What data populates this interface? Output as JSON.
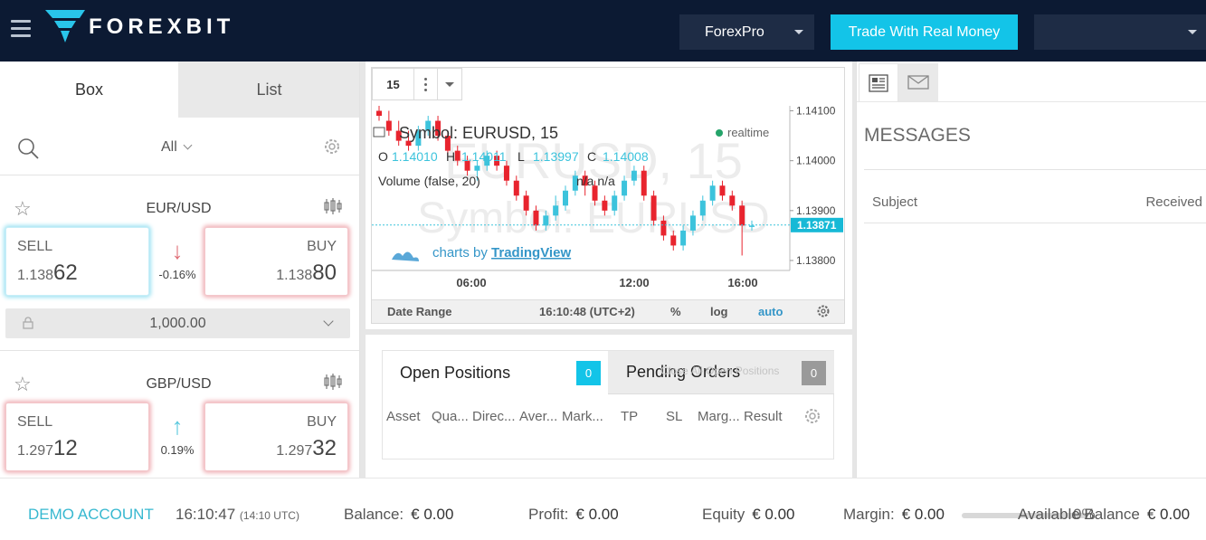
{
  "header": {
    "brand": "FOREXBIT",
    "account_selector": "ForexPro",
    "real_money_button": "Trade With Real Money",
    "user_selector": ""
  },
  "left_panel": {
    "tabs": [
      "Box",
      "List"
    ],
    "filter": "All",
    "pairs": [
      {
        "symbol": "EUR/USD",
        "sell_label": "SELL",
        "sell_prefix": "1.138",
        "sell_pips": "62",
        "buy_label": "BUY",
        "buy_prefix": "1.138",
        "buy_pips": "80",
        "change": "-0.16%",
        "direction": "down",
        "amount": "1,000.00"
      },
      {
        "symbol": "GBP/USD",
        "sell_label": "SELL",
        "sell_prefix": "1.297",
        "sell_pips": "12",
        "buy_label": "BUY",
        "buy_prefix": "1.297",
        "buy_pips": "32",
        "change": "0.19%",
        "direction": "up"
      }
    ]
  },
  "chart": {
    "interval": "15",
    "watermark_line1": "EURUSD, 15",
    "watermark_line2": "Symbol: EURUSD",
    "legend_title": "Symbol: EURUSD, 15",
    "realtime": "realtime",
    "ohlc": {
      "o_label": "O",
      "o": "1.14010",
      "h_label": "H",
      "h": "1.14011",
      "l_label": "L",
      "l": "1.13997",
      "c_label": "C",
      "c": "1.14008"
    },
    "volume_label": "Volume (false, 20)",
    "volume_values": "n/a  n/a",
    "attribution_prefix": "charts by",
    "attribution_brand": "TradingView",
    "footer": {
      "date_range": "Date Range",
      "time": "16:10:48 (UTC+2)",
      "percent": "%",
      "log": "log",
      "auto": "auto"
    },
    "colors": {
      "up": "#3cc3dc",
      "down": "#e8242e"
    }
  },
  "chart_data": {
    "type": "candlestick",
    "title": "Symbol: EURUSD, 15",
    "x_ticks": [
      "06:00",
      "12:00",
      "16:00"
    ],
    "y_ticks": [
      "1.14100",
      "1.14000",
      "1.13900",
      "1.13800"
    ],
    "ylim": [
      1.1378,
      1.1411
    ],
    "last_price": "1.13871",
    "candles": [
      {
        "o": 1.141,
        "c": 1.1409,
        "h": 1.1411,
        "l": 1.1408
      },
      {
        "o": 1.1408,
        "c": 1.1406,
        "h": 1.141,
        "l": 1.1405
      },
      {
        "o": 1.1406,
        "c": 1.1404,
        "h": 1.1408,
        "l": 1.1403
      },
      {
        "o": 1.1404,
        "c": 1.1403,
        "h": 1.1406,
        "l": 1.1402
      },
      {
        "o": 1.1403,
        "c": 1.1406,
        "h": 1.1407,
        "l": 1.1402
      },
      {
        "o": 1.1406,
        "c": 1.1408,
        "h": 1.1409,
        "l": 1.1405
      },
      {
        "o": 1.1408,
        "c": 1.1405,
        "h": 1.1409,
        "l": 1.1404
      },
      {
        "o": 1.1405,
        "c": 1.1402,
        "h": 1.1406,
        "l": 1.1401
      },
      {
        "o": 1.1402,
        "c": 1.14,
        "h": 1.1403,
        "l": 1.1399
      },
      {
        "o": 1.14,
        "c": 1.1398,
        "h": 1.1401,
        "l": 1.1397
      },
      {
        "o": 1.1398,
        "c": 1.1399,
        "h": 1.14,
        "l": 1.1396
      },
      {
        "o": 1.1399,
        "c": 1.1401,
        "h": 1.1402,
        "l": 1.1398
      },
      {
        "o": 1.1401,
        "c": 1.1399,
        "h": 1.1402,
        "l": 1.1398
      },
      {
        "o": 1.1399,
        "c": 1.1396,
        "h": 1.14,
        "l": 1.1395
      },
      {
        "o": 1.1396,
        "c": 1.1393,
        "h": 1.1397,
        "l": 1.1392
      },
      {
        "o": 1.1393,
        "c": 1.139,
        "h": 1.1394,
        "l": 1.1389
      },
      {
        "o": 1.139,
        "c": 1.1387,
        "h": 1.1391,
        "l": 1.1386
      },
      {
        "o": 1.1387,
        "c": 1.1389,
        "h": 1.139,
        "l": 1.1386
      },
      {
        "o": 1.1389,
        "c": 1.1391,
        "h": 1.1393,
        "l": 1.1388
      },
      {
        "o": 1.1391,
        "c": 1.1394,
        "h": 1.1395,
        "l": 1.139
      },
      {
        "o": 1.1394,
        "c": 1.1397,
        "h": 1.1398,
        "l": 1.1393
      },
      {
        "o": 1.1397,
        "c": 1.1395,
        "h": 1.1398,
        "l": 1.1393
      },
      {
        "o": 1.1395,
        "c": 1.1392,
        "h": 1.1396,
        "l": 1.1391
      },
      {
        "o": 1.1392,
        "c": 1.139,
        "h": 1.1393,
        "l": 1.1389
      },
      {
        "o": 1.139,
        "c": 1.1393,
        "h": 1.1394,
        "l": 1.1389
      },
      {
        "o": 1.1393,
        "c": 1.1396,
        "h": 1.1397,
        "l": 1.1392
      },
      {
        "o": 1.1396,
        "c": 1.1398,
        "h": 1.1399,
        "l": 1.1395
      },
      {
        "o": 1.1398,
        "c": 1.1393,
        "h": 1.1399,
        "l": 1.1392
      },
      {
        "o": 1.1393,
        "c": 1.1388,
        "h": 1.1394,
        "l": 1.1387
      },
      {
        "o": 1.1388,
        "c": 1.1385,
        "h": 1.1389,
        "l": 1.1384
      },
      {
        "o": 1.1385,
        "c": 1.1383,
        "h": 1.1386,
        "l": 1.1382
      },
      {
        "o": 1.1383,
        "c": 1.1386,
        "h": 1.1387,
        "l": 1.1382
      },
      {
        "o": 1.1386,
        "c": 1.1389,
        "h": 1.139,
        "l": 1.1385
      },
      {
        "o": 1.1389,
        "c": 1.1392,
        "h": 1.1393,
        "l": 1.1388
      },
      {
        "o": 1.1392,
        "c": 1.1395,
        "h": 1.1396,
        "l": 1.1391
      },
      {
        "o": 1.1395,
        "c": 1.1393,
        "h": 1.1396,
        "l": 1.1392
      },
      {
        "o": 1.1393,
        "c": 1.1391,
        "h": 1.1394,
        "l": 1.139
      },
      {
        "o": 1.1391,
        "c": 1.1387,
        "h": 1.1392,
        "l": 1.1381
      },
      {
        "o": 1.1387,
        "c": 1.1387,
        "h": 1.1388,
        "l": 1.1386
      }
    ]
  },
  "positions": {
    "open_label": "Open Positions",
    "open_count": "0",
    "pending_label": "Pending Orders",
    "pending_count": "0",
    "close_all": "Close All Open Positions",
    "columns": [
      "Asset",
      "Qua...",
      "Direc...",
      "Aver...",
      "Mark...",
      "TP",
      "SL",
      "Marg...",
      "Result"
    ]
  },
  "messages": {
    "title": "MESSAGES",
    "subject": "Subject",
    "received": "Received"
  },
  "footer": {
    "demo_label": "DEMO ACCOUNT",
    "time": "16:10:47",
    "time_utc": "(14:10 UTC)",
    "balance_label": "Balance:",
    "balance": "€ 0.00",
    "profit_label": "Profit:",
    "profit": "€ 0.00",
    "equity_label": "Equity",
    "equity": "€ 0.00",
    "margin_label": "Margin:",
    "margin": "€ 0.00",
    "available_label": "Available Balance",
    "available_pct": "0%",
    "available": "€ 0.00"
  }
}
